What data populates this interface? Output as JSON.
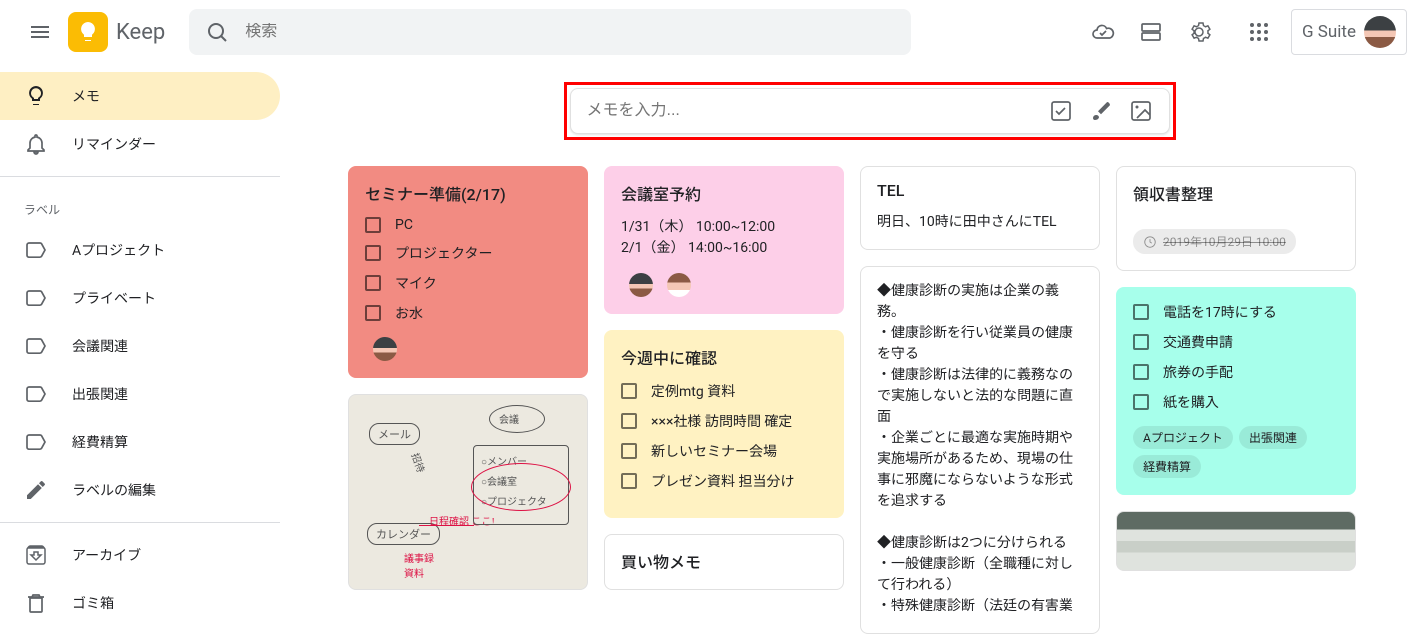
{
  "app": {
    "name": "Keep"
  },
  "search": {
    "placeholder": "検索"
  },
  "gsuite": {
    "label": "G Suite"
  },
  "sidebar": {
    "primary": [
      {
        "label": "メモ",
        "active": true,
        "icon": "bulb"
      },
      {
        "label": "リマインダー",
        "active": false,
        "icon": "bell"
      }
    ],
    "labels_header": "ラベル",
    "labels": [
      {
        "label": "Aプロジェクト"
      },
      {
        "label": "プライベート"
      },
      {
        "label": "会議関連"
      },
      {
        "label": "出張関連"
      },
      {
        "label": "経費精算"
      }
    ],
    "edit_labels": "ラベルの編集",
    "archive": "アーカイブ",
    "trash": "ゴミ箱"
  },
  "new_note": {
    "placeholder": "メモを入力..."
  },
  "notes": {
    "col1": [
      {
        "title": "セミナー準備(2/17)",
        "color": "coral",
        "checklist": [
          "PC",
          "プロジェクター",
          "マイク",
          "お水"
        ],
        "collaborators": 1
      },
      {
        "type": "image-whiteboard"
      }
    ],
    "col2": [
      {
        "title": "会議室予約",
        "color": "pink",
        "body": "1/31（木） 10:00~12:00\n2/1（金） 14:00~16:00",
        "collaborators": 2
      },
      {
        "title": "今週中に確認",
        "color": "yellow",
        "checklist": [
          "定例mtg 資料",
          "×××社様 訪問時間 確定",
          "新しいセミナー会場",
          "プレゼン資料 担当分け"
        ]
      },
      {
        "title": "買い物メモ",
        "color": "white",
        "body": ""
      }
    ],
    "col3": [
      {
        "title": "TEL",
        "color": "white",
        "body": "明日、10時に田中さんにTEL"
      },
      {
        "title": "",
        "color": "white",
        "body": "◆健康診断の実施は企業の義務。\n・健康診断を行い従業員の健康を守る\n・健康診断は法律的に義務なので実施しないと法的な問題に直面\n・企業ごとに最適な実施時期や実施場所があるため、現場の仕事に邪魔にならないような形式を追求する\n\n◆健康診断は2つに分けられる\n・一般健康診断（全職種に対して行われる）\n・特殊健康診断（法廷の有害業"
      }
    ],
    "col4": [
      {
        "title": "領収書整理",
        "color": "white",
        "reminder": "2019年10月29日 10:00"
      },
      {
        "title": "",
        "color": "teal",
        "checklist": [
          "電話を17時にする",
          "交通費申請",
          "旅券の手配",
          "紙を購入"
        ],
        "labels": [
          "Aプロジェクト",
          "出張関連",
          "経費精算"
        ]
      },
      {
        "type": "image-photo"
      }
    ]
  },
  "whiteboard": {
    "mail": "メール",
    "calendar": "カレンダー",
    "meeting": "会議",
    "member": "○メンバー",
    "room": "○会議室",
    "projector": "○プロジェクタ",
    "invite": "招待",
    "schedule_check": "日程確認 ここ!",
    "agenda1": "議事録",
    "agenda2": "資料"
  }
}
